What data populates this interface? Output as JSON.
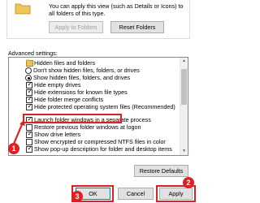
{
  "top_section": {
    "description": "You can apply this view (such as Details or Icons) to all folders of this type.",
    "apply_button": "Apply to Folders",
    "reset_button": "Reset Folders"
  },
  "advanced": {
    "label": "Advanced settings:",
    "items": [
      {
        "kind": "folder",
        "label": "Hidden files and folders",
        "checked": false
      },
      {
        "kind": "radio",
        "label": "Don't show hidden files, folders, or drives",
        "checked": false
      },
      {
        "kind": "radio",
        "label": "Show hidden files, folders, and drives",
        "checked": true
      },
      {
        "kind": "checkbox",
        "label": "Hide empty drives",
        "checked": true
      },
      {
        "kind": "checkbox",
        "label": "Hide extensions for known file types",
        "checked": true
      },
      {
        "kind": "checkbox",
        "label": "Hide folder merge conflicts",
        "checked": true
      },
      {
        "kind": "checkbox",
        "label": "Hide protected operating system files (Recommended)",
        "checked": true
      },
      {
        "kind": "checkbox",
        "label": "Launch folder windows in a separate process",
        "checked": true
      },
      {
        "kind": "checkbox",
        "label": "Restore previous folder windows at logon",
        "checked": false
      },
      {
        "kind": "checkbox",
        "label": "Show drive letters",
        "checked": true
      },
      {
        "kind": "checkbox",
        "label": "Show encrypted or compressed NTFS files in color",
        "checked": false
      },
      {
        "kind": "checkbox",
        "label": "Show pop-up description for folder and desktop items",
        "checked": true
      }
    ]
  },
  "restore_defaults": "Restore Defaults",
  "footer": {
    "ok": "OK",
    "cancel": "Cancel",
    "apply": "Apply"
  },
  "markers": {
    "m1": "1",
    "m2": "2",
    "m3": "3"
  },
  "colors": {
    "annotation": "#e02020",
    "accent": "#0078d7"
  }
}
